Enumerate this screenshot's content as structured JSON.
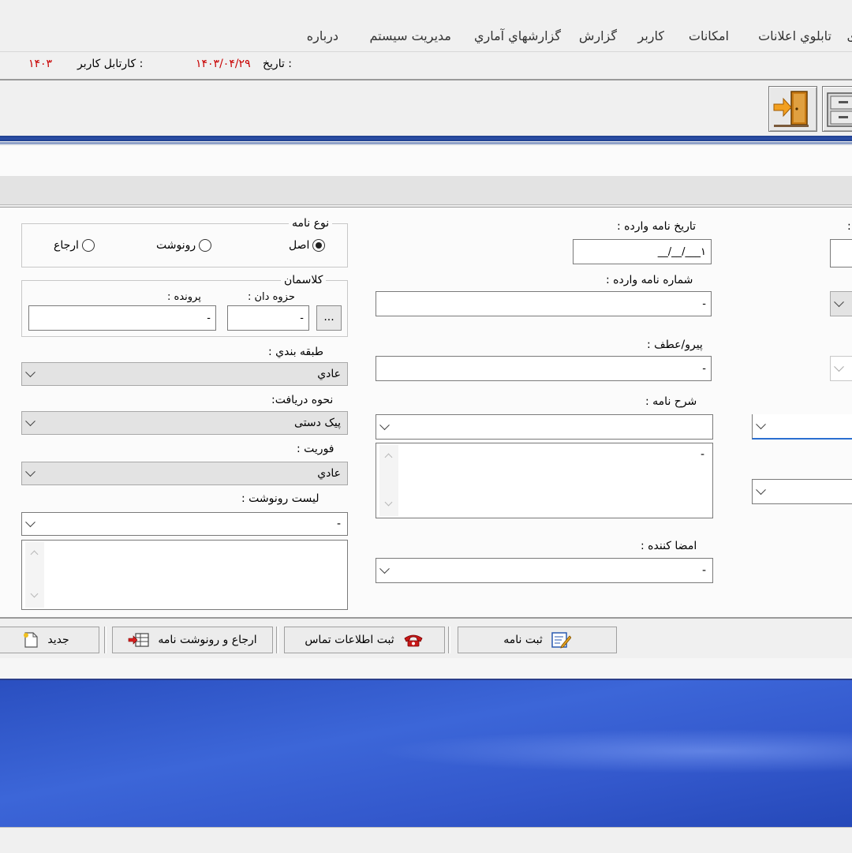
{
  "menu": {
    "items": [
      "تابلوي اعلانات",
      "امكانات",
      "كاربر",
      "گزارش",
      "گزارشهاي آماري",
      "مديريت سيستم",
      "درباره"
    ],
    "partial_item": "ی"
  },
  "info_bar": {
    "date_label": "تاريخ :",
    "date_value": "۱۴۰۳/۰۴/۲۹",
    "cartable_label": "كارتابل كاربر :",
    "cartable_value": "۱۴۰۳"
  },
  "toolbar": {
    "exit_icon": "exit-door-icon",
    "cabinet_icon": "file-cabinet-icon"
  },
  "form": {
    "letter_type": {
      "title": "نوع نامه",
      "options": [
        "اصل",
        "رونوشت",
        "ارجاع"
      ],
      "selected": "اصل"
    },
    "classifier": {
      "title": "كلاسمان",
      "binder_label": "حزوه دان :",
      "binder_value": "-",
      "file_label": "پرونده :",
      "file_value": "-",
      "browse_label": "..."
    },
    "classification": {
      "label": "طبقه بندي :",
      "value": "عادي"
    },
    "receive_method": {
      "label": "نحوه دريافت:",
      "value": "پيک دستی"
    },
    "urgency": {
      "label": "فوريت :",
      "value": "عادي"
    },
    "cc_list": {
      "label": "ليست رونوشت :",
      "value": "-"
    },
    "incoming_date": {
      "label": "تاريخ نامه وارده :",
      "value": "۱___/__/__"
    },
    "incoming_number": {
      "label": "شماره نامه وارده :",
      "value": "-"
    },
    "followup": {
      "label": "پيرو/عطف :",
      "value": "-"
    },
    "description": {
      "label": "شرح نامه :",
      "combo_value": "",
      "memo_value": "-"
    },
    "signer": {
      "label": "امضا كننده :",
      "value": "-"
    }
  },
  "actions": {
    "register_label": "ثبت نامه",
    "contact_label": "ثبت اطلاعات تماس",
    "refer_cc_label": "ارجاع و رونوشت نامه",
    "new_label": "جديد"
  },
  "colors": {
    "accent_blue": "#2c4ea8",
    "date_red": "#c80000",
    "desktop_blue": "#3c66d8"
  }
}
